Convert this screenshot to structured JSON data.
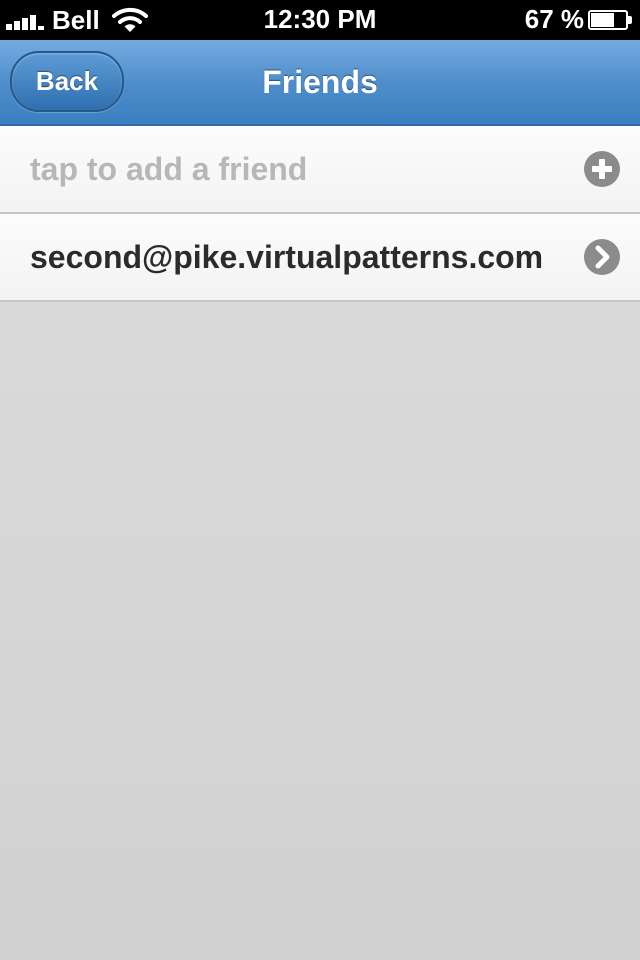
{
  "status_bar": {
    "carrier": "Bell",
    "time": "12:30 PM",
    "battery_percent": "67 %",
    "battery_level": 0.67,
    "icons": [
      "signal-icon",
      "wifi-icon",
      "battery-icon"
    ]
  },
  "nav": {
    "back_label": "Back",
    "title": "Friends",
    "accent_color": "#4f8ecb"
  },
  "friends_list": {
    "add_placeholder": "tap to add a friend",
    "add_icon": "plus-circle-icon",
    "items": [
      {
        "label": "second@pike.virtualpatterns.com",
        "icon": "chevron-right-icon"
      }
    ]
  }
}
